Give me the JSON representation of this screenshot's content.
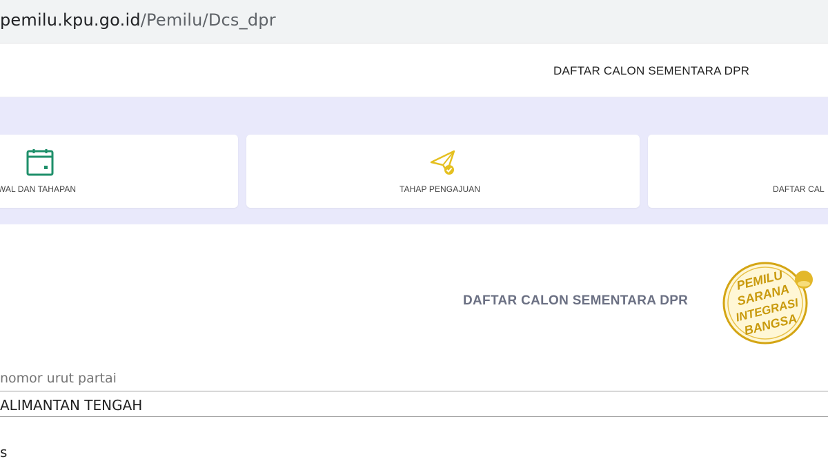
{
  "browser": {
    "url_host": "pemilu.kpu.go.id",
    "url_path": "/Pemilu/Dcs_dpr"
  },
  "header": {
    "title": "DAFTAR CALON SEMENTARA DPR"
  },
  "nav_cards": [
    {
      "label": "ADWAL DAN TAHAPAN",
      "icon": "calendar-icon"
    },
    {
      "label": "TAHAP PENGAJUAN",
      "icon": "paper-plane-check-icon"
    },
    {
      "label": "DAFTAR CAL",
      "icon": ""
    }
  ],
  "section": {
    "title": "DAFTAR CALON SEMENTARA DPR",
    "logo_text": [
      "PEMILU",
      "SARANA",
      "INTEGRASI",
      "BANGSA"
    ]
  },
  "form": {
    "field_label": "nomor urut partai",
    "field_value": "ALIMANTAN TENGAH",
    "next_fragment": "s"
  },
  "colors": {
    "band": "#e9e9fb",
    "calendar_icon": "#1e8f6a",
    "send_icon": "#e5c020",
    "logo_gold": "#d4a514",
    "section_title": "#6b7083"
  }
}
